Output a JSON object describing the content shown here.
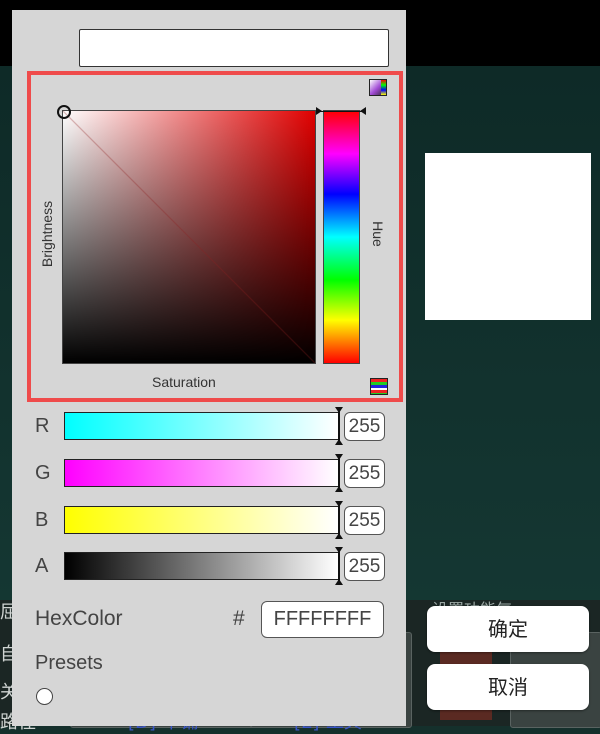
{
  "picker": {
    "brightness_label": "Brightness",
    "hue_label": "Hue",
    "saturation_label": "Saturation"
  },
  "channels": [
    {
      "label": "R",
      "value": "255"
    },
    {
      "label": "G",
      "value": "255"
    },
    {
      "label": "B",
      "value": "255"
    },
    {
      "label": "A",
      "value": "255"
    }
  ],
  "hex": {
    "label": "HexColor",
    "hash": "#",
    "value": "FFFFFFFF"
  },
  "presets": {
    "label": "Presets"
  },
  "buttons": {
    "ok": "确定",
    "cancel": "取消"
  },
  "background": {
    "left_chars": [
      "屈",
      "自",
      "关",
      "路径"
    ],
    "item_d": "[D]-平铺",
    "item_e": "[E]-工具",
    "partial_label": "设置功能气"
  },
  "colors": {
    "current": "#FFFFFFFF",
    "hue": "#FF0000",
    "highlight_border": "#EF4B4B"
  },
  "icons": [
    "color-mode-icon",
    "slider-mode-icon"
  ]
}
